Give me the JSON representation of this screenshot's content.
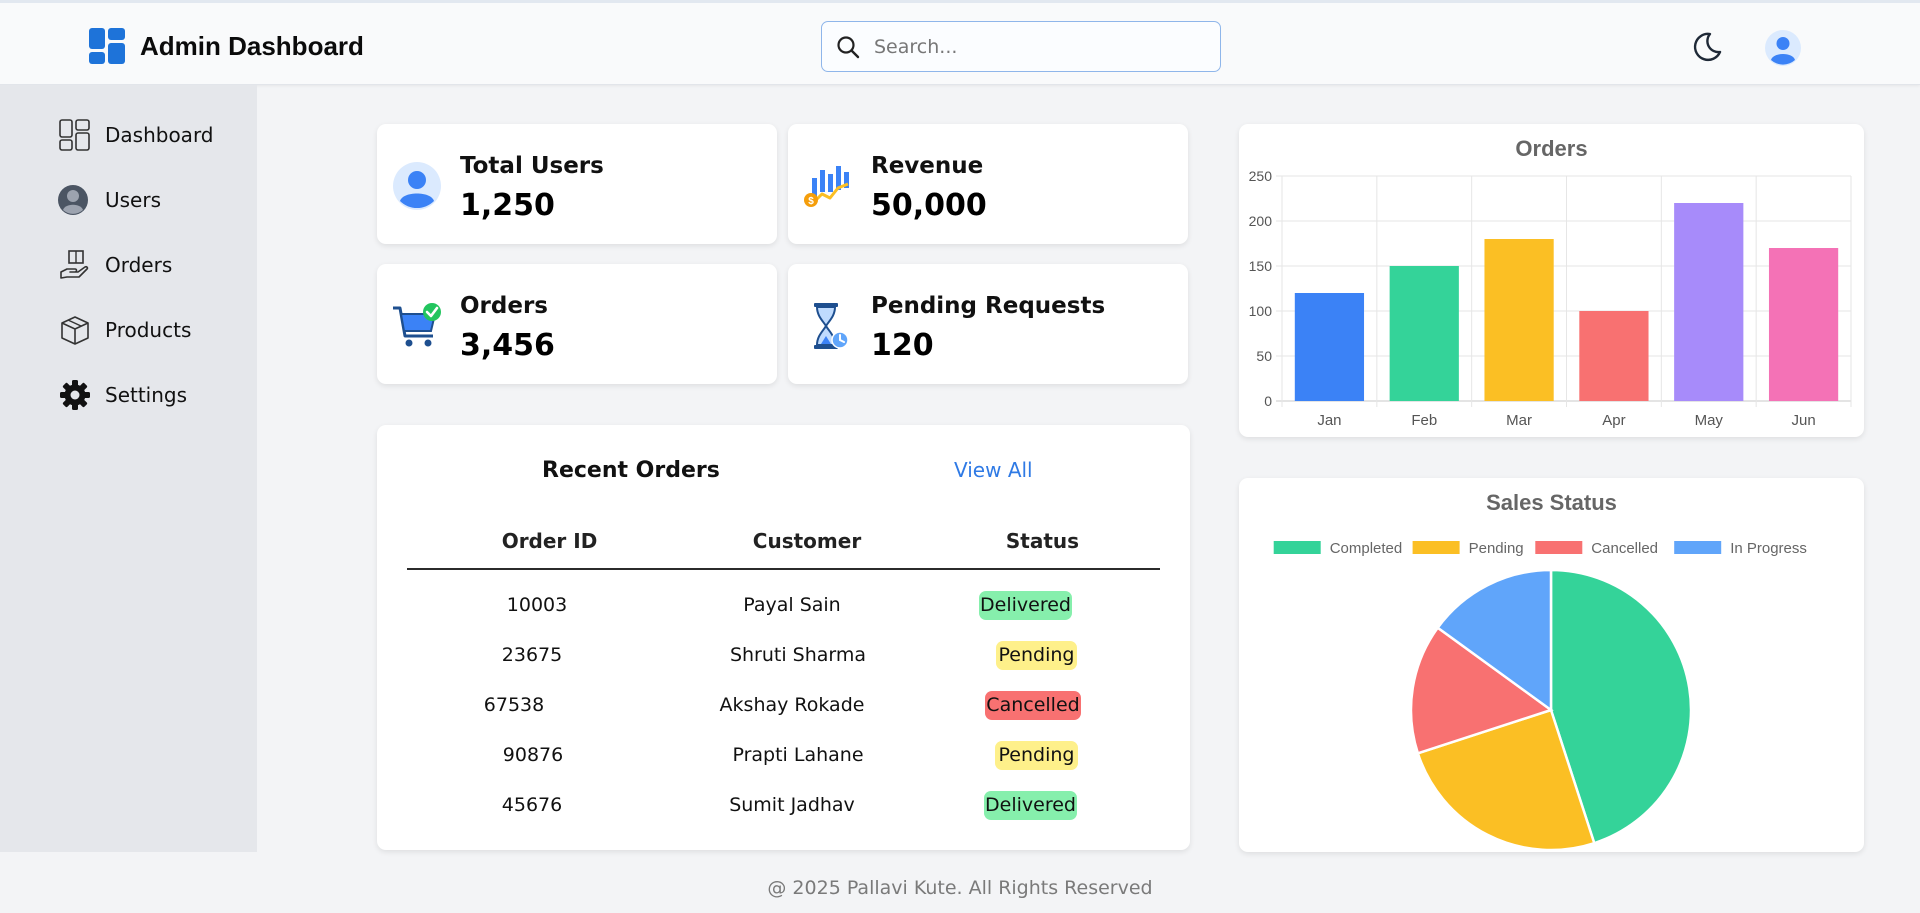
{
  "header": {
    "title": "Admin Dashboard",
    "logo_icon": "dashboard-grid-icon",
    "search_placeholder": "Search...",
    "search_value": "",
    "theme_toggle_icon": "moon-icon",
    "profile_icon": "user-avatar-icon"
  },
  "sidebar": {
    "items": [
      {
        "label": "Dashboard",
        "icon": "dashboard-icon"
      },
      {
        "label": "Users",
        "icon": "user-icon"
      },
      {
        "label": "Orders",
        "icon": "orders-icon"
      },
      {
        "label": "Products",
        "icon": "box-icon"
      },
      {
        "label": "Settings",
        "icon": "gear-icon"
      }
    ]
  },
  "stats": [
    {
      "label": "Total Users",
      "value": "1,250",
      "icon": "user-avatar-icon"
    },
    {
      "label": "Revenue",
      "value": "50,000",
      "icon": "revenue-chart-icon"
    },
    {
      "label": "Orders",
      "value": "3,456",
      "icon": "cart-check-icon"
    },
    {
      "label": "Pending Requests",
      "value": "120",
      "icon": "hourglass-icon"
    }
  ],
  "recent_orders": {
    "title": "Recent Orders",
    "view_all": "View All",
    "columns": [
      "Order ID",
      "Customer",
      "Status"
    ],
    "rows": [
      {
        "id": "10003",
        "customer": "Payal Sain",
        "status": "Delivered"
      },
      {
        "id": "23675",
        "customer": "Shruti Sharma",
        "status": "Pending"
      },
      {
        "id": "67538",
        "customer": "Akshay Rokade",
        "status": "Cancelled"
      },
      {
        "id": "90876",
        "customer": "Prapti Lahane",
        "status": "Pending"
      },
      {
        "id": "45676",
        "customer": "Sumit Jadhav",
        "status": "Delivered"
      }
    ],
    "status_colors": {
      "Delivered": "#86efac",
      "Pending": "#fef08a",
      "Cancelled": "#f87171"
    }
  },
  "chart_data": [
    {
      "type": "bar",
      "title": "Orders",
      "categories": [
        "Jan",
        "Feb",
        "Mar",
        "Apr",
        "May",
        "Jun"
      ],
      "values": [
        120,
        150,
        180,
        100,
        220,
        170
      ],
      "colors": [
        "#3b82f6",
        "#34d399",
        "#fbbf24",
        "#f87171",
        "#a78bfa",
        "#f472b6"
      ],
      "ylim": [
        0,
        250
      ],
      "yticks": [
        0,
        50,
        100,
        150,
        200,
        250
      ],
      "grid": true
    },
    {
      "type": "pie",
      "title": "Sales Status",
      "labels": [
        "Completed",
        "Pending",
        "Cancelled",
        "In Progress"
      ],
      "values": [
        45,
        25,
        15,
        15
      ],
      "colors": [
        "#34d399",
        "#fbbf24",
        "#f87171",
        "#60a5fa"
      ],
      "legend": "top"
    }
  ],
  "footer": {
    "text": "@ 2025 Pallavi Kute. All Rights Reserved"
  }
}
